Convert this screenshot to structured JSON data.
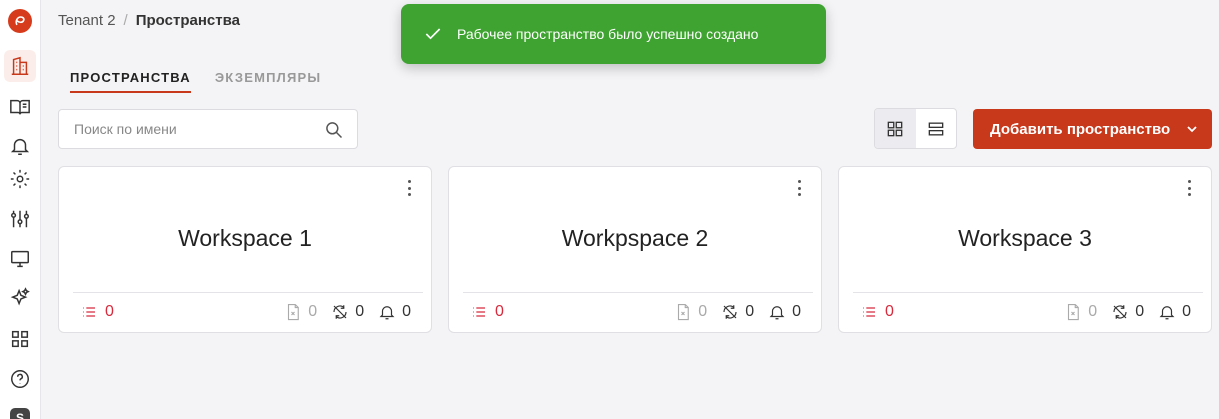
{
  "sidebar": {
    "items": [
      {
        "icon": "building-icon",
        "active": true
      },
      {
        "icon": "book-icon"
      },
      {
        "icon": "bell-icon"
      },
      {
        "icon": "gear-icon"
      },
      {
        "icon": "sliders-icon"
      },
      {
        "icon": "monitor-icon"
      },
      {
        "icon": "sparkles-icon"
      },
      {
        "icon": "grid-icon"
      },
      {
        "icon": "help-icon"
      }
    ],
    "avatar_letter": "S"
  },
  "breadcrumb": {
    "tenant": "Tenant 2",
    "separator": "/",
    "current": "Пространства"
  },
  "tabs": [
    {
      "label": "ПРОСТРАНСТВА",
      "active": true
    },
    {
      "label": "ЭКЗЕМПЛЯРЫ",
      "active": false
    }
  ],
  "search": {
    "placeholder": "Поиск по имени",
    "value": ""
  },
  "view_toggle": {
    "selected": "grid"
  },
  "add_button": {
    "label": "Добавить пространство"
  },
  "toast": {
    "message": "Рабочее пространство было успешно создано"
  },
  "colors": {
    "accent": "#c8391c",
    "toast": "#3ea330",
    "danger": "#d62a3d"
  },
  "workspaces": [
    {
      "name": "Workspace 1",
      "tasks": "0",
      "files": "0",
      "sync": "0",
      "alerts": "0"
    },
    {
      "name": "Workpspace 2",
      "tasks": "0",
      "files": "0",
      "sync": "0",
      "alerts": "0"
    },
    {
      "name": "Workspace 3",
      "tasks": "0",
      "files": "0",
      "sync": "0",
      "alerts": "0"
    }
  ]
}
